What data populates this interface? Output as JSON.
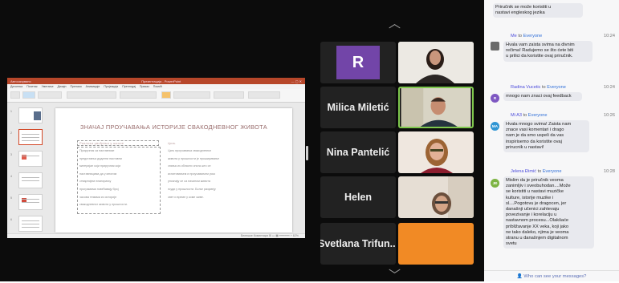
{
  "share": {
    "titlebar_left": "Автосачувано",
    "titlebar_center": "Презентација - PowerPoint",
    "menu": [
      "Датотека",
      "Почетак",
      "Уметање",
      "Дизајн",
      "Прелази",
      "Анимације",
      "Пројекција",
      "Прегледај",
      "Приказ",
      "Помоћ"
    ],
    "slide_numbers": [
      "1",
      "2",
      "3",
      "4",
      "5",
      "6"
    ],
    "slide": {
      "title": "ЗНАЧАЈ ПРОУЧАВАЊА ИСТОРИЈЕ СВАКОДНЕВНОГ ЖИВОТА",
      "left_heading": "Разлози увођења у школе",
      "right_heading": "Циљ",
      "left_lines": [
        "Приручник за наставнике",
        "представља додатни наставни",
        "материјал који приручник који",
        "наставницима да у многим",
        "стварнијем планирању",
        "програмима повећавају број",
        "часова темама из историје",
        "свакодневног живота у прошлости."
      ],
      "right_lines": [
        "Циљ проучавања свакодневног",
        "живота у прошлости је проширивање",
        "знања из области онога што се",
        "испитивањем и проучавањем уско",
        "упознају се са начином живота",
        "људи у прошлости. Боље разумеју",
        "свет и време у коме живе."
      ]
    },
    "status": "Белешке   Коментари   ⊞  ▭  ▦   ━━━━━━  +  62%"
  },
  "participants": {
    "r_initial": "R",
    "names": [
      "Milica Miletić",
      "Nina Pantelić",
      "Helen",
      "Svetlana Trifun..."
    ]
  },
  "chat": {
    "messages": [
      {
        "sender": "",
        "to": "",
        "time": "",
        "text": [
          "Priručnik se može koristiti u",
          "nastavi engleskog jezika"
        ]
      },
      {
        "sender": "Me",
        "to": "Everyone",
        "time": "10:24",
        "avatar": "photo",
        "text": [
          "Hvala vam zaista svima na divnim",
          "rečima! Radujemo se što ćete biti",
          "u prilici da koristite ovaj priručnik."
        ]
      },
      {
        "sender": "Radina Vucetic",
        "to": "Everyone",
        "time": "10:24",
        "avatar": "R",
        "avatar_color": "#7e57c2",
        "text": [
          "mnogo nam znaci ovaj feedback"
        ]
      },
      {
        "sender": "Mi A3",
        "to": "Everyone",
        "time": "10:26",
        "avatar": "MA",
        "avatar_color": "#2f95d4",
        "text": [
          "Hvala mnogo svima! Zaista nam",
          "znace vasi komentari i drago",
          "nam je da smo uspeli da vas",
          "inspirisemo da koristite ovaj",
          "prirucnik u nastavi!"
        ]
      },
      {
        "sender": "Jelena Đimić",
        "to": "Everyone",
        "time": "10:28",
        "avatar": "JĐ",
        "avatar_color": "#7cb342",
        "text": [
          "Mislim da je priručnik veoma",
          "zanimljiv i sveobuhodan....Može",
          "se koristiti u nastavi muzičke",
          "kulture, istorije muzike i",
          "sl....Pogotovu je dragocen, jer",
          "današnji učenici zahtevaju",
          "povezivanje i korelaciju u",
          "nastavnom procesu...Olakšaće",
          "približavanje XX veka, koji jako",
          "ne tako daleko, njima je veoma",
          "stranu u današnjem digitalnom",
          "svetu"
        ]
      }
    ],
    "to_word": "to",
    "footer": "Who can see your messages?"
  }
}
